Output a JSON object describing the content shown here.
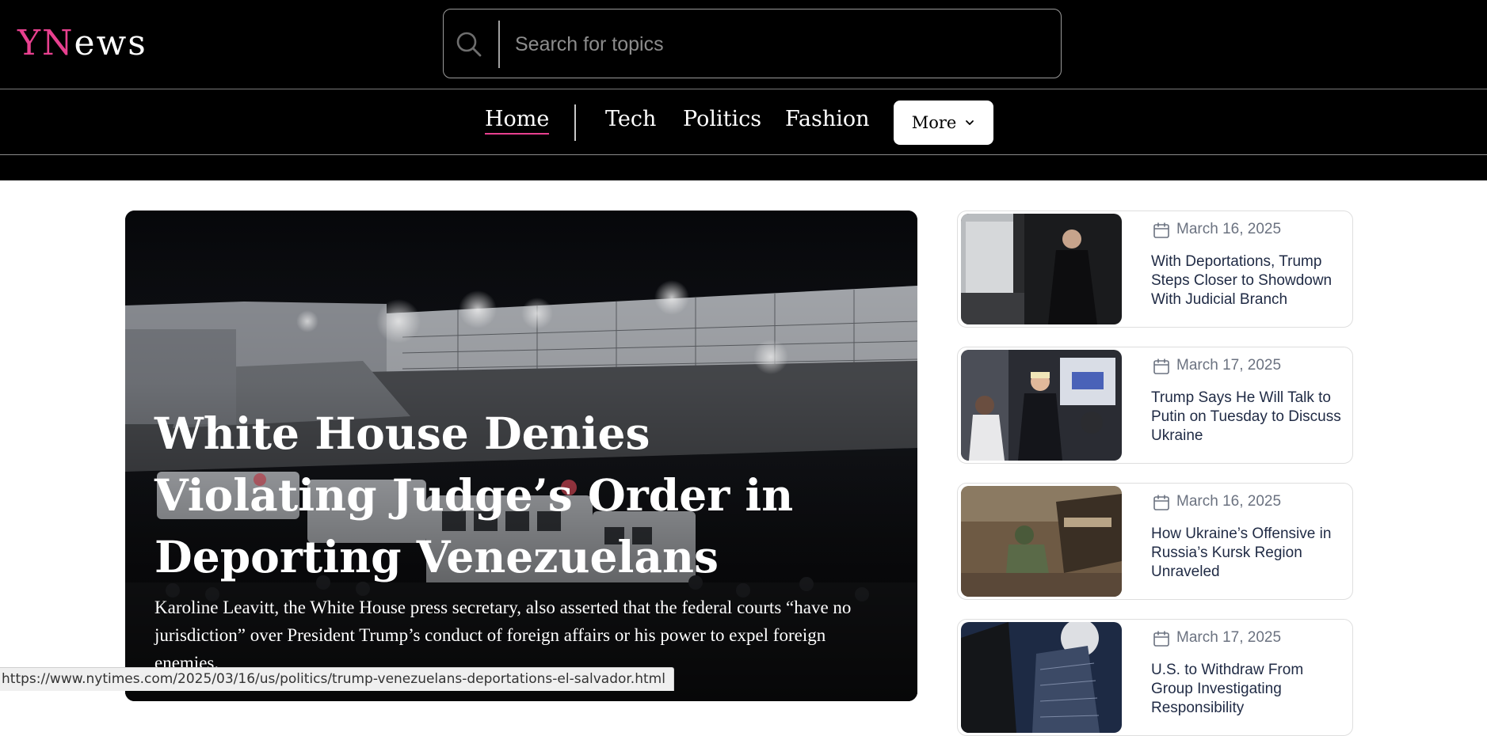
{
  "brand": {
    "logo_accent": "YN",
    "logo_rest": "ews",
    "accent_color": "#e8408f"
  },
  "search": {
    "placeholder": "Search for topics",
    "icon": "search-icon"
  },
  "nav": {
    "items": [
      {
        "label": "Home",
        "active": true
      },
      {
        "label": "Tech",
        "active": false
      },
      {
        "label": "Politics",
        "active": false
      },
      {
        "label": "Fashion",
        "active": false
      }
    ],
    "more_label": "More",
    "more_icon": "chevron-down-icon"
  },
  "hero": {
    "title": "White House Denies Violating Judge’s Order in Deporting Venezuelans",
    "summary": "Karoline Leavitt, the White House press secretary, also asserted that the federal courts “have no jurisdiction” over President Trump’s conduct of foreign affairs or his power to expel foreign enemies."
  },
  "side_articles": [
    {
      "date": "March 16, 2025",
      "headline": "With Deportations, Trump Steps Closer to Showdown With Judicial Branch",
      "icon": "calendar-icon"
    },
    {
      "date": "March 17, 2025",
      "headline": "Trump Says He Will Talk to Putin on Tuesday to Discuss Ukraine",
      "icon": "calendar-icon"
    },
    {
      "date": "March 16, 2025",
      "headline": "How Ukraine’s Offensive in Russia’s Kursk Region Unraveled",
      "icon": "calendar-icon"
    },
    {
      "date": "March 17, 2025",
      "headline": "U.S. to Withdraw From Group Investigating Responsibility",
      "icon": "calendar-icon"
    }
  ],
  "status_bar": {
    "url": "https://www.nytimes.com/2025/03/16/us/politics/trump-venezuelans-deportations-el-salvador.html"
  }
}
